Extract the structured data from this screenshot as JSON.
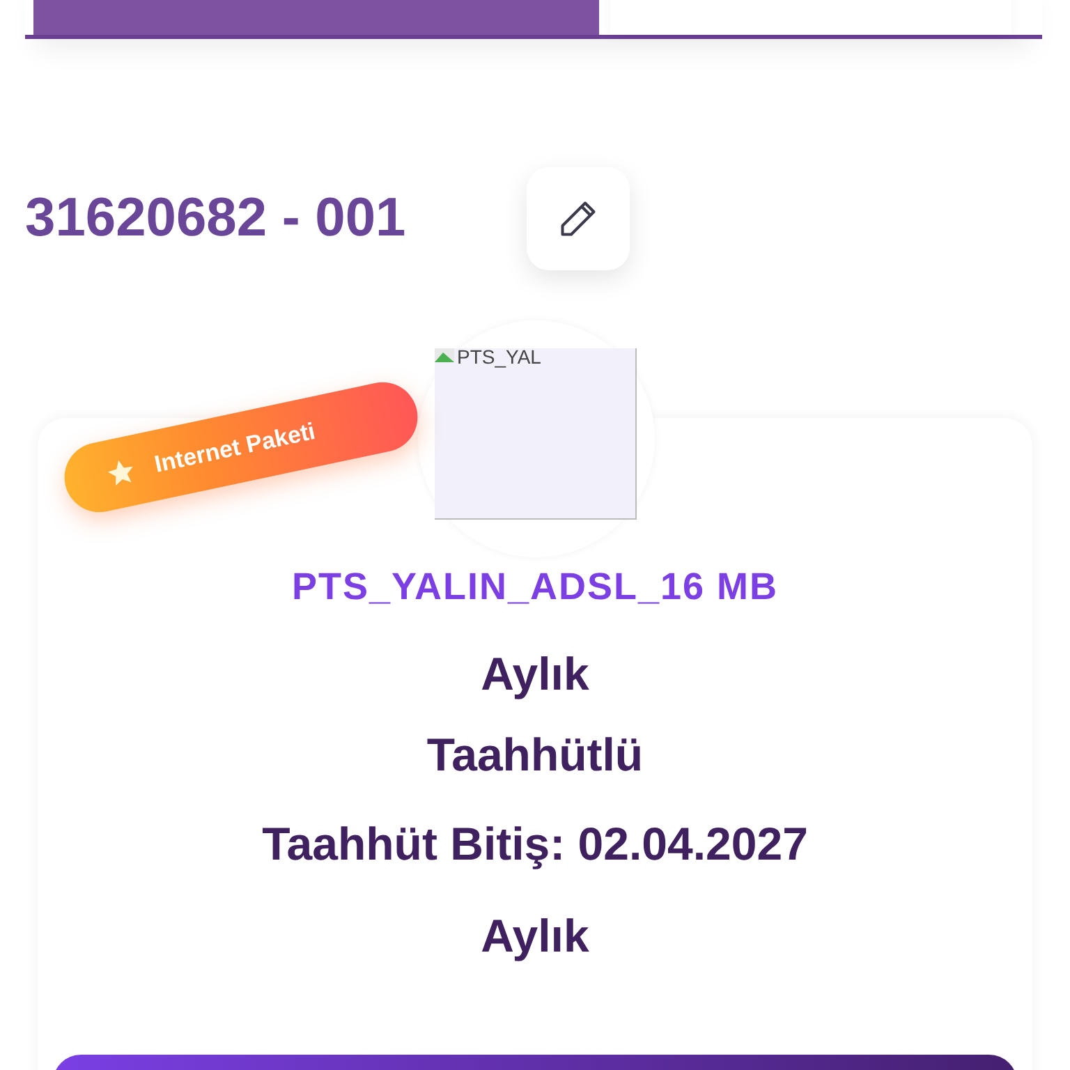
{
  "tabs": [
    {
      "selected": true
    },
    {
      "selected": false
    }
  ],
  "subscription": {
    "number": "31620682 - 001"
  },
  "package": {
    "badge": "Internet Paketi",
    "image_alt": "PTS_YAL",
    "name": "PTS_YALIN_ADSL_16 MB",
    "details": [
      "Aylık",
      "Taahhütlü",
      "Taahhüt Bitiş: 02.04.2027",
      "Aylık"
    ]
  }
}
